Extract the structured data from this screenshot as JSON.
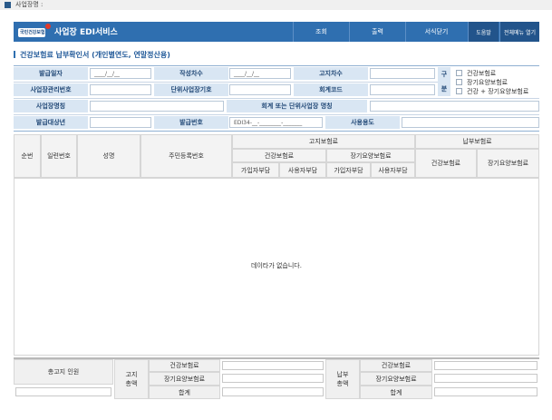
{
  "topbar": {
    "label": "사업장명 :"
  },
  "header": {
    "logo_text": "국민건강보험",
    "title": "사업장 EDI서비스",
    "menu": [
      "조회",
      "출력",
      "서식닫기"
    ],
    "help": "도움말",
    "all_menu": "전체메뉴 열기"
  },
  "section_title": "건강보험료 납부확인서 (개인별연도, 연말정산용)",
  "form": {
    "issue_date_label": "발급일자",
    "issue_date_value": "____/__/__",
    "write_order_label": "작성차수",
    "write_order_value": "____/__/__",
    "notice_order_label": "고지차수",
    "biz_no_label": "사업장관리번호",
    "unit_biz_label": "단위사업장기호",
    "account_code_label": "회계코드",
    "biz_name_label": "사업장명칭",
    "account_unit_name_label": "회계 또는 단위사업장 명칭",
    "target_year_label": "발급대상년",
    "issue_no_label": "발급번호",
    "issue_no_value": "EDI34-__-________-_______",
    "usage_label": "사용용도",
    "category_label_1": "구",
    "category_label_2": "분",
    "category_options": [
      "건강보험료",
      "장기요양보험료",
      "건강 + 장기요양보험료"
    ]
  },
  "grid": {
    "col_seq": "순번",
    "col_serial": "일련번호",
    "col_name": "성명",
    "col_rrn": "주민등록번호",
    "notice_group": "고지보험료",
    "paid_group": "납부보험료",
    "health": "건강보험료",
    "longterm": "장기요양보험료",
    "sub_member": "가입자부담",
    "sub_employer": "사용자부담",
    "paid_health": "건강보험료",
    "paid_longterm": "장기요양보험료",
    "no_data": "데이타가 없습니다."
  },
  "footer": {
    "total_label": "총고지 인원",
    "notice_total": "고지\n총액",
    "paid_total": "납부\n총액",
    "health": "건강보험료",
    "longterm": "장기요양보험료",
    "sum": "합계"
  },
  "colors": {
    "header": "#2f6fb0",
    "label_bg": "#d9e6f3",
    "label_text": "#234a78"
  }
}
